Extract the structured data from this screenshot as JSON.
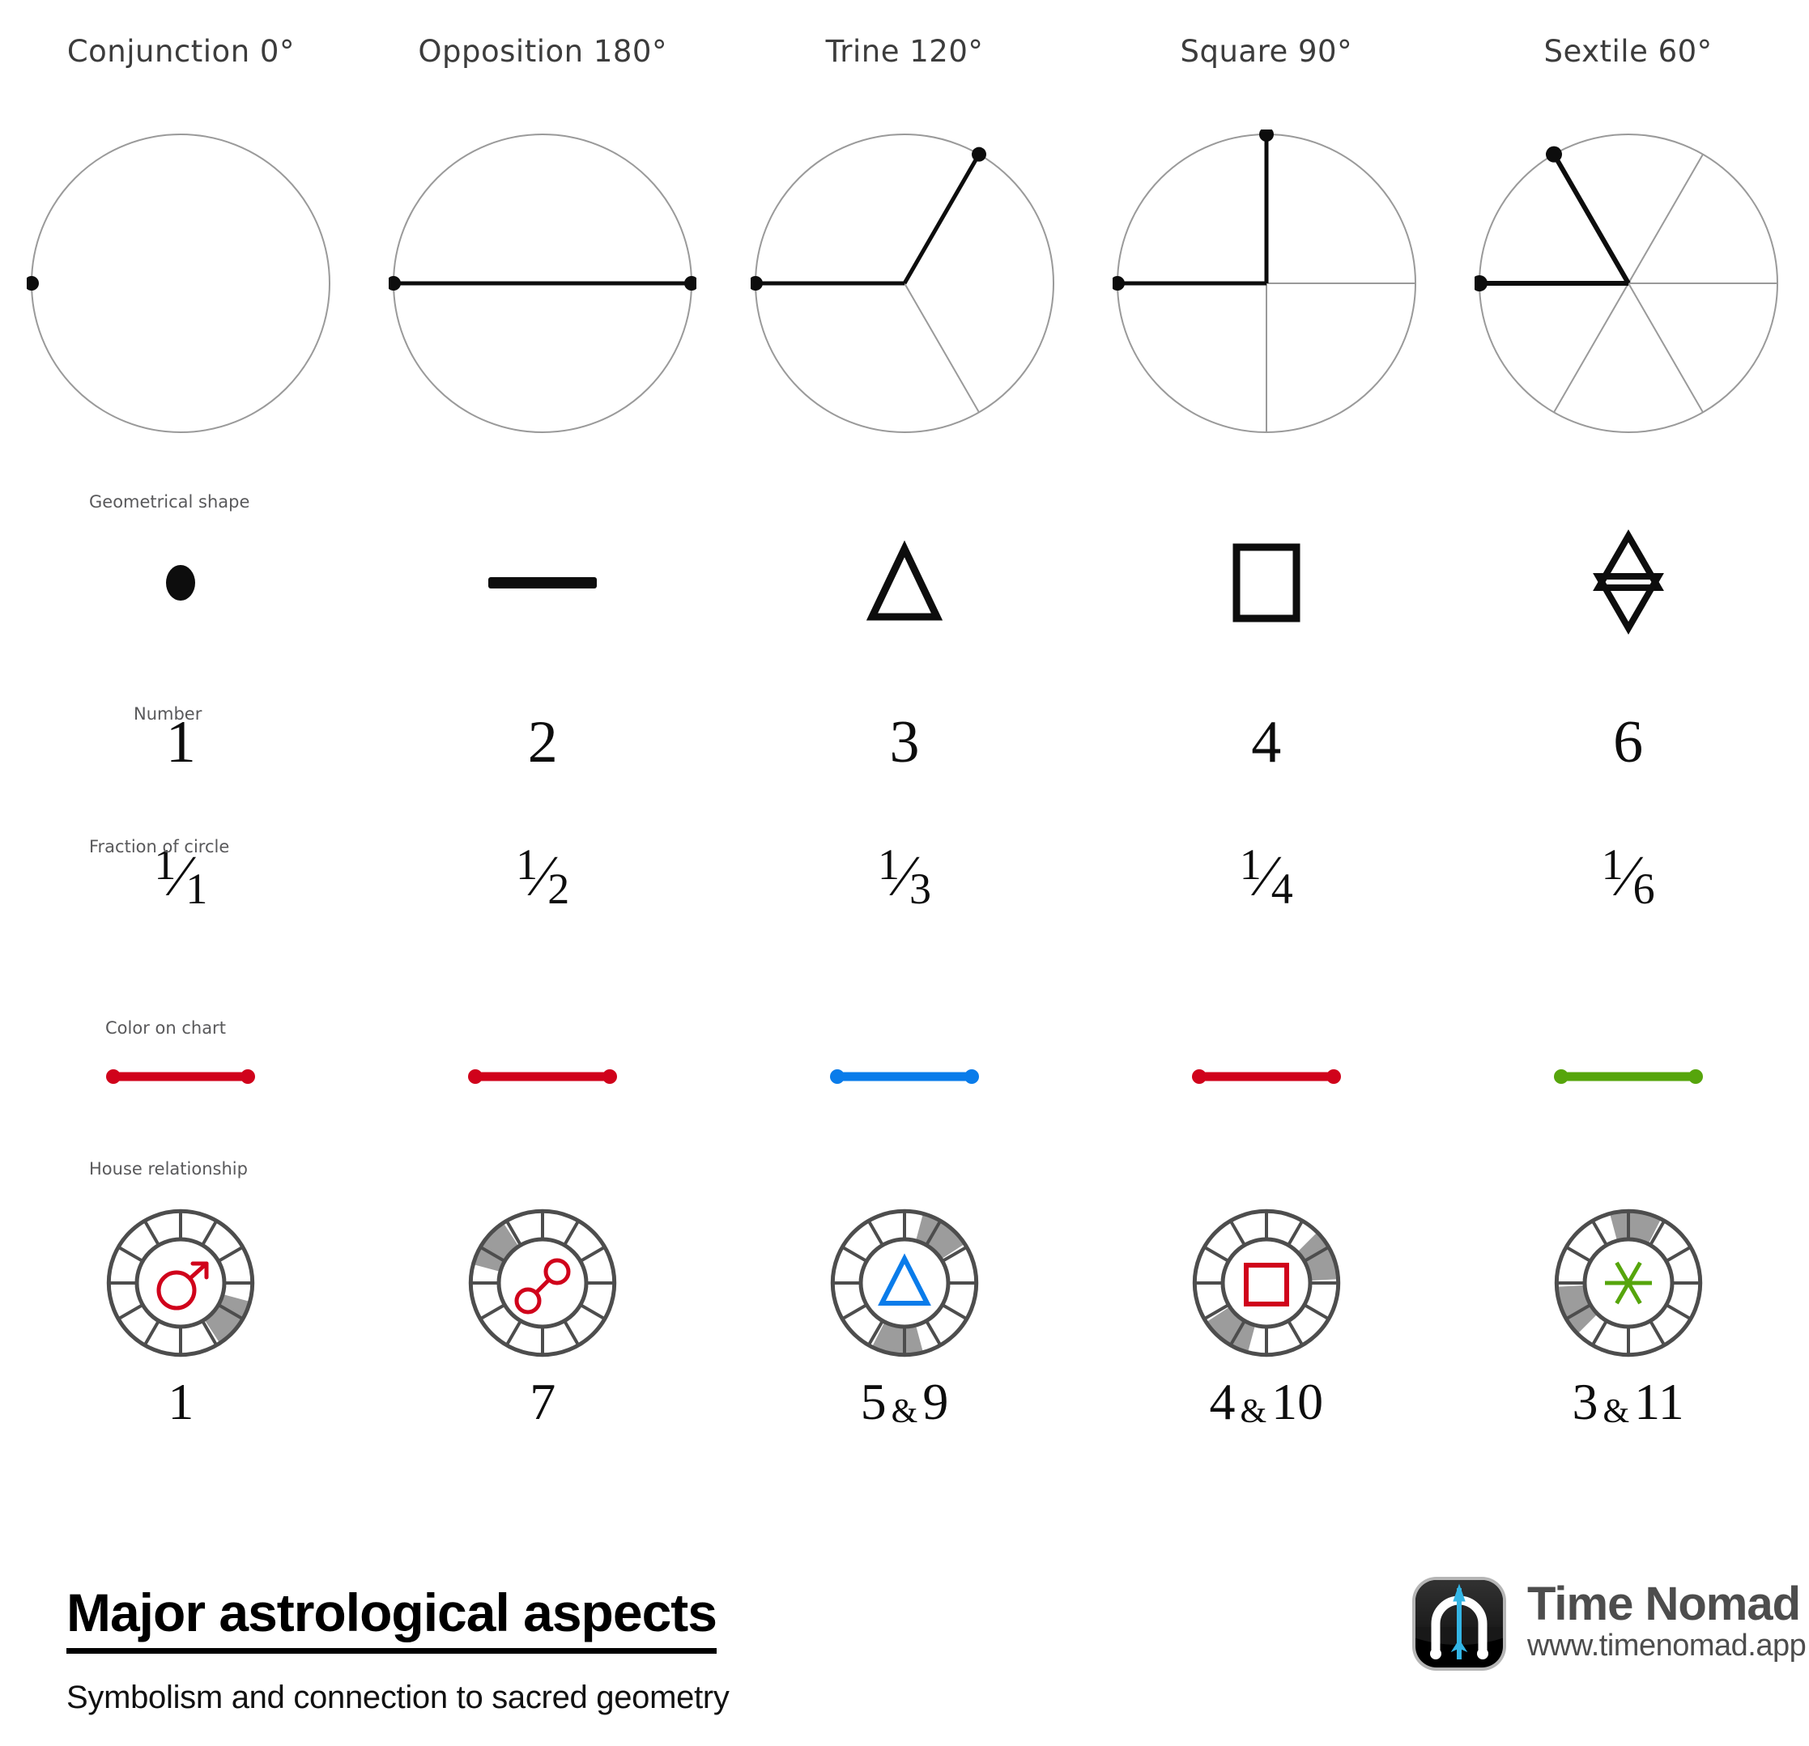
{
  "meta": {
    "title": "Major astrological aspects",
    "subtitle": "Symbolism and connection to sacred geometry"
  },
  "row_labels": {
    "geometrical_shape": "Geometrical shape",
    "number": "Number",
    "fraction_of_circle": "Fraction of circle",
    "color_on_chart": "Color on chart",
    "house_relationship": "House relationship"
  },
  "colors": {
    "red": "#D0021B",
    "blue": "#0A7CEA",
    "green": "#56A50C",
    "gray_line": "#9a9a9a",
    "black": "#0d0d0d",
    "wheel_stroke": "#4d4d4d",
    "wheel_fill": "#9c9c9c",
    "label_gray": "#59595b",
    "header_gray": "#3c3c3c"
  },
  "chart_data": {
    "type": "table",
    "title": "Major astrological aspects",
    "columns": [
      "Conjunction 0°",
      "Opposition 180°",
      "Trine 120°",
      "Square 90°",
      "Sextile 60°"
    ],
    "rows": [
      "Geometrical shape",
      "Number",
      "Fraction of circle",
      "Color on chart",
      "House relationship"
    ],
    "values": {
      "angle_degrees": [
        0,
        180,
        120,
        90,
        60
      ],
      "geometrical_shape": [
        "point",
        "line",
        "triangle",
        "square",
        "hexagram"
      ],
      "number": [
        "1",
        "2",
        "3",
        "4",
        "6"
      ],
      "fraction_of_circle": [
        "1/1",
        "1/2",
        "1/3",
        "1/4",
        "1/6"
      ],
      "color_on_chart": [
        "#D0021B",
        "#D0021B",
        "#0A7CEA",
        "#D0021B",
        "#56A50C"
      ],
      "house_relationship": [
        "1",
        "7",
        "5 & 9",
        "4 & 10",
        "3 & 11"
      ]
    }
  },
  "aspects": [
    {
      "name": "Conjunction",
      "header": "Conjunction 0°",
      "angle": 0,
      "divisions": 1,
      "active_angles": [
        180
      ],
      "shape": "point",
      "shape_name": "point-shape",
      "number": "1",
      "fraction": {
        "numerator": "1",
        "denominator": "1"
      },
      "color": "#D0021B",
      "glyph": "conjunction-glyph",
      "glyph_color": "#D0021B",
      "houses_label": "1",
      "houses": [
        "1"
      ],
      "highlight_houses": [
        1
      ]
    },
    {
      "name": "Opposition",
      "header": "Opposition 180°",
      "angle": 180,
      "divisions": 2,
      "active_angles": [
        180,
        0
      ],
      "shape": "line",
      "shape_name": "line-shape",
      "number": "2",
      "fraction": {
        "numerator": "1",
        "denominator": "2"
      },
      "color": "#D0021B",
      "glyph": "opposition-glyph",
      "glyph_color": "#D0021B",
      "houses_label": "7",
      "houses": [
        "7"
      ],
      "highlight_houses": [
        7
      ]
    },
    {
      "name": "Trine",
      "header": "Trine 120°",
      "angle": 120,
      "divisions": 3,
      "active_angles": [
        180,
        60
      ],
      "shape": "triangle",
      "shape_name": "triangle-shape",
      "number": "3",
      "fraction": {
        "numerator": "1",
        "denominator": "3"
      },
      "color": "#0A7CEA",
      "glyph": "trine-glyph",
      "glyph_color": "#0A7CEA",
      "houses_label": "5 & 9",
      "houses": [
        "5",
        "9"
      ],
      "highlight_houses": [
        5,
        9
      ]
    },
    {
      "name": "Square",
      "header": "Square 90°",
      "angle": 90,
      "divisions": 4,
      "active_angles": [
        180,
        90
      ],
      "shape": "square",
      "shape_name": "square-shape",
      "number": "4",
      "fraction": {
        "numerator": "1",
        "denominator": "4"
      },
      "color": "#D0021B",
      "glyph": "square-glyph",
      "glyph_color": "#D0021B",
      "houses_label": "4 & 10",
      "houses": [
        "4",
        "10"
      ],
      "highlight_houses": [
        4,
        10
      ]
    },
    {
      "name": "Sextile",
      "header": "Sextile 60°",
      "angle": 60,
      "divisions": 6,
      "active_angles": [
        180,
        120
      ],
      "shape": "hexagram",
      "shape_name": "hexagram-shape",
      "number": "6",
      "fraction": {
        "numerator": "1",
        "denominator": "6"
      },
      "color": "#56A50C",
      "glyph": "sextile-glyph",
      "glyph_color": "#56A50C",
      "houses_label": "3 & 11",
      "houses": [
        "3",
        "11"
      ],
      "highlight_houses": [
        3,
        11
      ]
    }
  ],
  "brand": {
    "name": "Time Nomad",
    "url": "www.timenomad.app",
    "logo": "time-nomad-app-icon"
  }
}
